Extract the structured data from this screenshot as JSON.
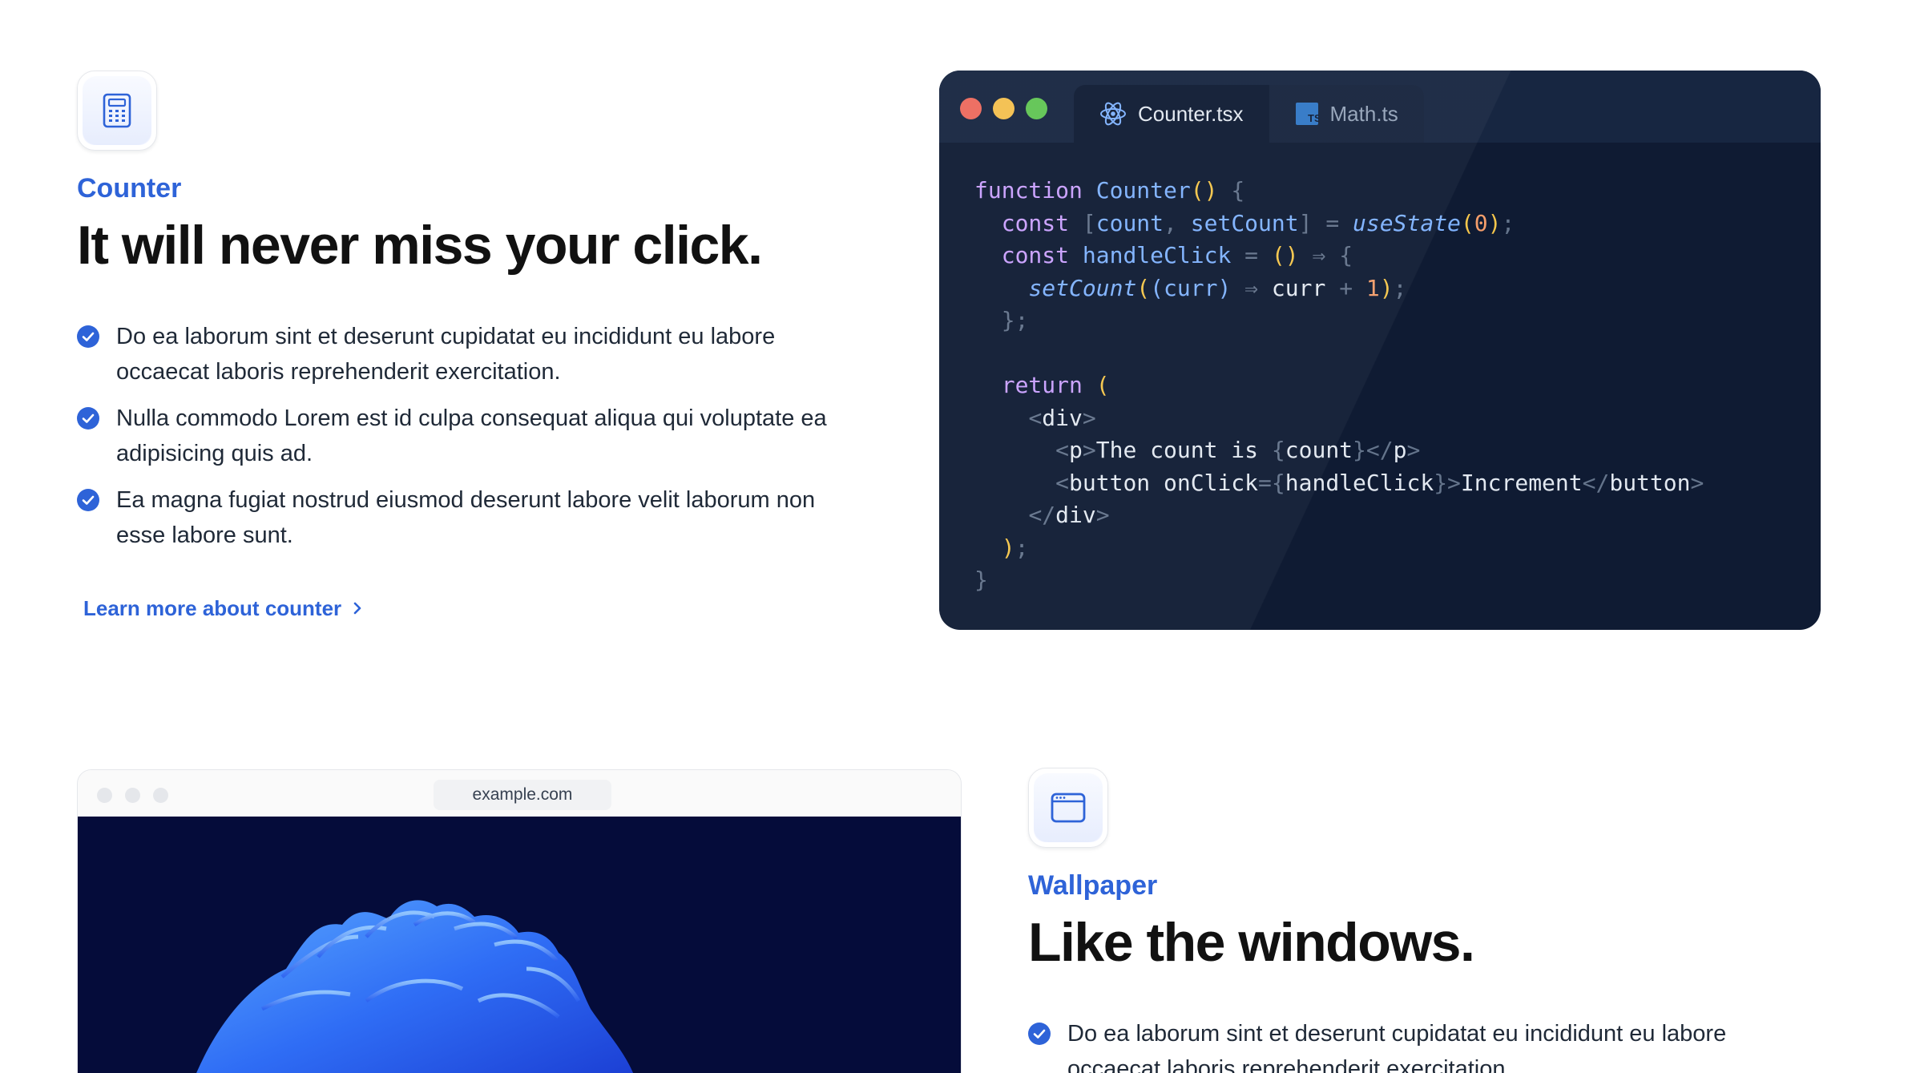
{
  "counter_section": {
    "eyebrow": "Counter",
    "headline": "It will never miss your click.",
    "bullets": [
      "Do ea laborum sint et deserunt cupidatat eu incididunt eu labore occaecat laboris reprehenderit exercitation.",
      "Nulla commodo Lorem est id culpa consequat aliqua qui voluptate ea adipisicing quis ad.",
      "Ea magna fugiat nostrud eiusmod deserunt labore velit laborum non esse labore sunt."
    ],
    "learn_more": "Learn more about counter",
    "icon": "calculator-icon"
  },
  "editor": {
    "tabs": [
      {
        "label": "Counter.tsx",
        "icon": "react-icon",
        "active": true
      },
      {
        "label": "Math.ts",
        "icon": "typescript-icon",
        "active": false
      }
    ],
    "traffic_lights": {
      "close": "#ec6a5e",
      "minimize": "#f4bf4f",
      "maximize": "#61c554"
    },
    "code_lines": [
      "function Counter() {",
      "  const [count, setCount] = useState(0);",
      "  const handleClick = () ⇒ {",
      "    setCount((curr) ⇒ curr + 1);",
      "  };",
      "",
      "  return (",
      "    <div>",
      "      <p>The count is {count}</p>",
      "      <button onClick={handleClick}>Increment</button>",
      "    </div>",
      "  );",
      "}"
    ]
  },
  "browser": {
    "url": "example.com",
    "image": "abstract-blue-wallpaper"
  },
  "wallpaper_section": {
    "eyebrow": "Wallpaper",
    "headline": "Like the windows.",
    "bullets": [
      "Do ea laborum sint et deserunt cupidatat eu incididunt eu labore occaecat laboris reprehenderit exercitation."
    ],
    "icon": "app-window-icon"
  },
  "colors": {
    "accent": "#2e63d8",
    "editor_bg": "#0f1b33"
  }
}
